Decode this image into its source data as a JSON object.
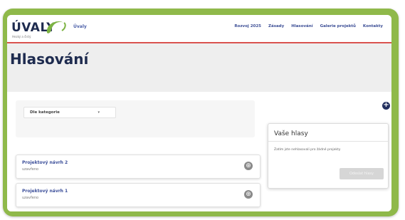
{
  "header": {
    "logo_text": "ÚVALY",
    "logo_tagline": "Hezký a čistý",
    "site_name": "Úvaly",
    "nav": [
      "Rozvoj 2025",
      "Zásady",
      "Hlasování",
      "Galerie projektů",
      "Kontakty"
    ],
    "accent_color": "#d9534f",
    "logo_swoosh_color": "#7cb342"
  },
  "page": {
    "title": "Hlasování"
  },
  "filter": {
    "category_selected": "Dle kategorie",
    "caret": "▾"
  },
  "projects": [
    {
      "name": "Projektový návrh 2",
      "status": "uzavřeno",
      "action_icon": "⊕"
    },
    {
      "name": "Projektový návrh 1",
      "status": "uzavřeno",
      "action_icon": "⊕"
    }
  ],
  "add_button_icon": "+",
  "votes": {
    "title": "Vaše hlasy",
    "empty_text": "Zatím jste nehlasovali pro žádné projekty",
    "submit_label": "Odeslat hlasy"
  },
  "colors": {
    "frame": "#8fb94a",
    "brand_navy": "#1e2b4f",
    "link": "#3c4f9a"
  }
}
